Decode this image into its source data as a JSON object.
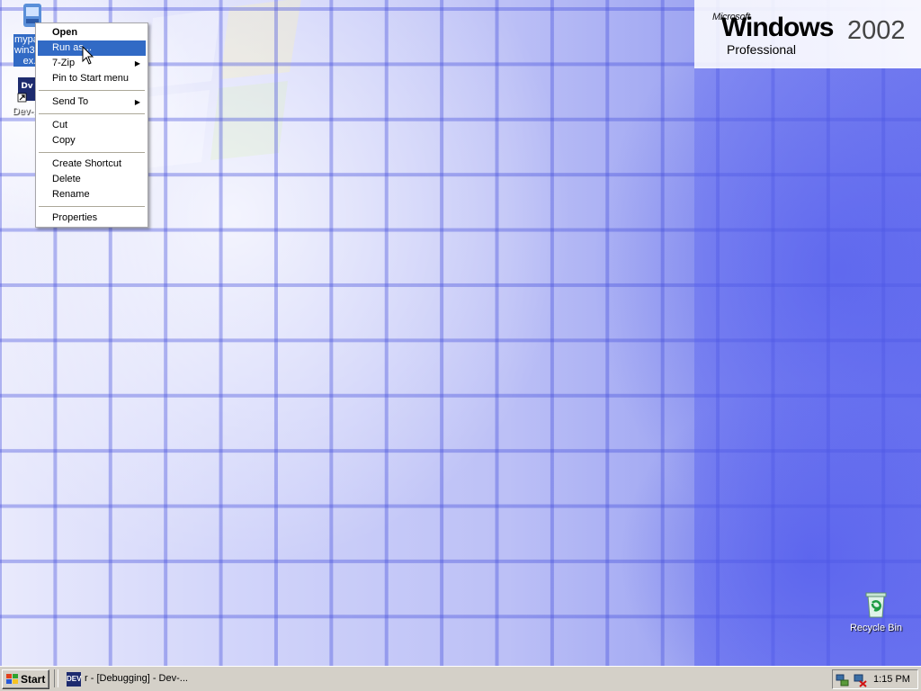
{
  "desktop": {
    "brand": {
      "microsoft": "Microsoft",
      "windows": "Windows",
      "year": "2002",
      "edition": "Professional"
    },
    "icons": [
      {
        "label": "mypal-...\nwin32.i...\nex...",
        "icon": "installer-icon",
        "selected": true
      },
      {
        "label": "Dev-...",
        "icon": "devcpp-shortcut-icon",
        "selected": false
      },
      {
        "label": "Recycle Bin",
        "icon": "recycle-bin-icon",
        "selected": false
      }
    ]
  },
  "context_menu": {
    "items": [
      {
        "label": "Open",
        "bold": true
      },
      {
        "label": "Run as...",
        "highlighted": true
      },
      {
        "label": "7-Zip",
        "submenu": true
      },
      {
        "label": "Pin to Start menu"
      },
      {
        "separator": true
      },
      {
        "label": "Send To",
        "submenu": true
      },
      {
        "separator": true
      },
      {
        "label": "Cut"
      },
      {
        "label": "Copy"
      },
      {
        "separator": true
      },
      {
        "label": "Create Shortcut"
      },
      {
        "label": "Delete"
      },
      {
        "label": "Rename"
      },
      {
        "separator": true
      },
      {
        "label": "Properties"
      }
    ]
  },
  "taskbar": {
    "start_label": "Start",
    "task_label": "r - [Debugging] - Dev-...",
    "task_icon_text": "DEV",
    "clock": "1:15 PM"
  },
  "colors": {
    "selection": "#316ac5",
    "taskbar": "#d4d0c8"
  }
}
